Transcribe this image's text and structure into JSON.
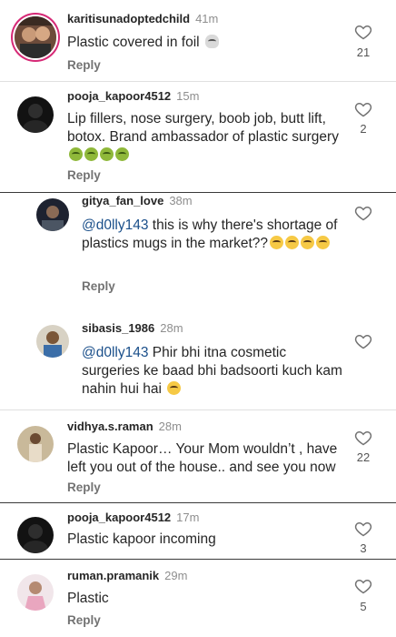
{
  "comments": [
    {
      "user": "karitisunadoptedchild",
      "time": "41m",
      "text": "Plastic covered in foil",
      "emoji": "skull",
      "reply": "Reply",
      "likes": "21"
    },
    {
      "user": "pooja_kapoor4512",
      "time": "15m",
      "text": "Lip fillers,  nose surgery, boob job, butt lift, botox. Brand ambassador of plastic surgery",
      "emoji": "sick-x4",
      "reply": "Reply",
      "likes": "2"
    },
    {
      "user": "gitya_fan_love",
      "time": "38m",
      "mention": "@d0lly143",
      "text": " this is why there's shortage of plastics mugs in the market??",
      "emoji": "astonished, laugh-x3",
      "reply": "Reply",
      "likes": ""
    },
    {
      "user": "sibasis_1986",
      "time": "28m",
      "mention": "@d0lly143",
      "text": " Phir bhi itna cosmetic surgeries ke baad bhi badsoorti kuch kam nahin hui hai",
      "emoji": "laugh",
      "reply": "",
      "likes": ""
    },
    {
      "user": "vidhya.s.raman",
      "time": "28m",
      "text": "Plastic Kapoor… Your Mom wouldn’t , have left you out of the house.. and see you now",
      "reply": "Reply",
      "likes": "22"
    },
    {
      "user": "pooja_kapoor4512",
      "time": "17m",
      "text": "Plastic kapoor incoming",
      "reply": "",
      "likes": "3"
    },
    {
      "user": "ruman.pramanik",
      "time": "29m",
      "text": "Plastic",
      "reply": "Reply",
      "likes": "5"
    }
  ],
  "icons": {
    "like": "heart-outline-icon"
  },
  "colors": {
    "mention": "#1a4f8a",
    "story_ring": "#d62976",
    "secondary_text": "#8e8e8e"
  }
}
